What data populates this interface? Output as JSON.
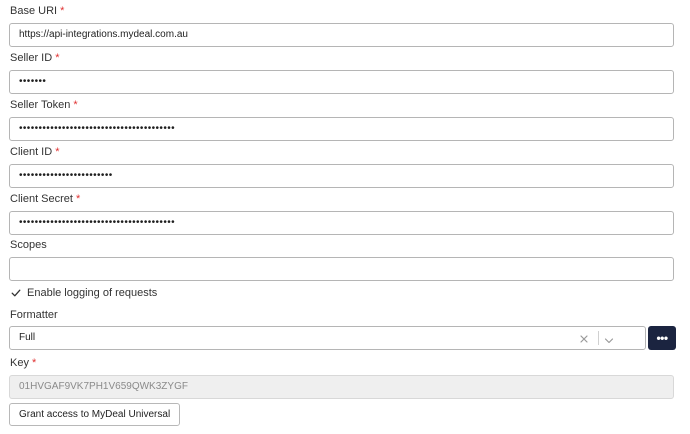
{
  "fields": {
    "base_uri": {
      "label": "Base URI",
      "required": "*",
      "value": "https://api-integrations.mydeal.com.au"
    },
    "seller_id": {
      "label": "Seller ID",
      "required": "*",
      "value": "•••••••"
    },
    "seller_token": {
      "label": "Seller Token",
      "required": "*",
      "value": "••••••••••••••••••••••••••••••••••••••••"
    },
    "client_id": {
      "label": "Client ID",
      "required": "*",
      "value": "••••••••••••••••••••••••"
    },
    "client_secret": {
      "label": "Client Secret",
      "required": "*",
      "value": "••••••••••••••••••••••••••••••••••••••••"
    },
    "scopes": {
      "label": "Scopes",
      "value": ""
    }
  },
  "logging": {
    "label": "Enable logging of requests",
    "checked": true
  },
  "formatter": {
    "label": "Formatter",
    "selected": "Full",
    "more_label": "•••"
  },
  "key": {
    "label": "Key",
    "required": "*",
    "value": "01HVGAF9VK7PH1V659QWK3ZYGF"
  },
  "grant_button": {
    "label": "Grant access to MyDeal Universal"
  },
  "icons": {
    "clear": "close-icon",
    "dropdown": "chevron-down-icon",
    "check": "checkmark-icon",
    "more": "more-dots-icon"
  },
  "colors": {
    "required": "#e03131",
    "primary_button": "#1b2440",
    "border": "#b5b5b5",
    "readonly_bg": "#efefef"
  }
}
